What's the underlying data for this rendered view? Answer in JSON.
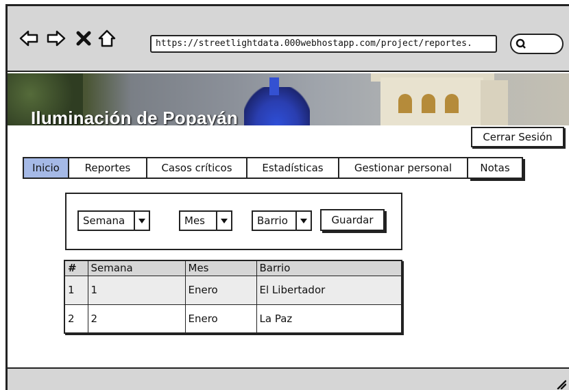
{
  "browser": {
    "url": "https://streetlightdata.000webhostapp.com/project/reportes.",
    "nav_icons": [
      "back-arrow-icon",
      "forward-arrow-icon",
      "close-icon",
      "home-icon"
    ],
    "search_icon": "search-icon"
  },
  "header": {
    "title": "Iluminación de Popayán",
    "logout_label": "Cerrar Sesión"
  },
  "tabs": [
    {
      "label": "Inicio",
      "active": true
    },
    {
      "label": "Reportes",
      "active": false
    },
    {
      "label": "Casos críticos",
      "active": false
    },
    {
      "label": "Estadísticas",
      "active": false
    },
    {
      "label": "Gestionar personal",
      "active": false
    },
    {
      "label": "Notas",
      "active": false
    }
  ],
  "filters": {
    "week": "Semana",
    "month": "Mes",
    "neighborhood": "Barrio",
    "save_label": "Guardar"
  },
  "table": {
    "headers": [
      "#",
      "Semana",
      "Mes",
      "Barrio"
    ],
    "rows": [
      [
        "1",
        "1",
        "Enero",
        "El Libertador"
      ],
      [
        "2",
        "2",
        "Enero",
        "La Paz"
      ]
    ]
  },
  "colors": {
    "active_tab": "#a5b9e6",
    "chrome": "#d6d6d6"
  }
}
